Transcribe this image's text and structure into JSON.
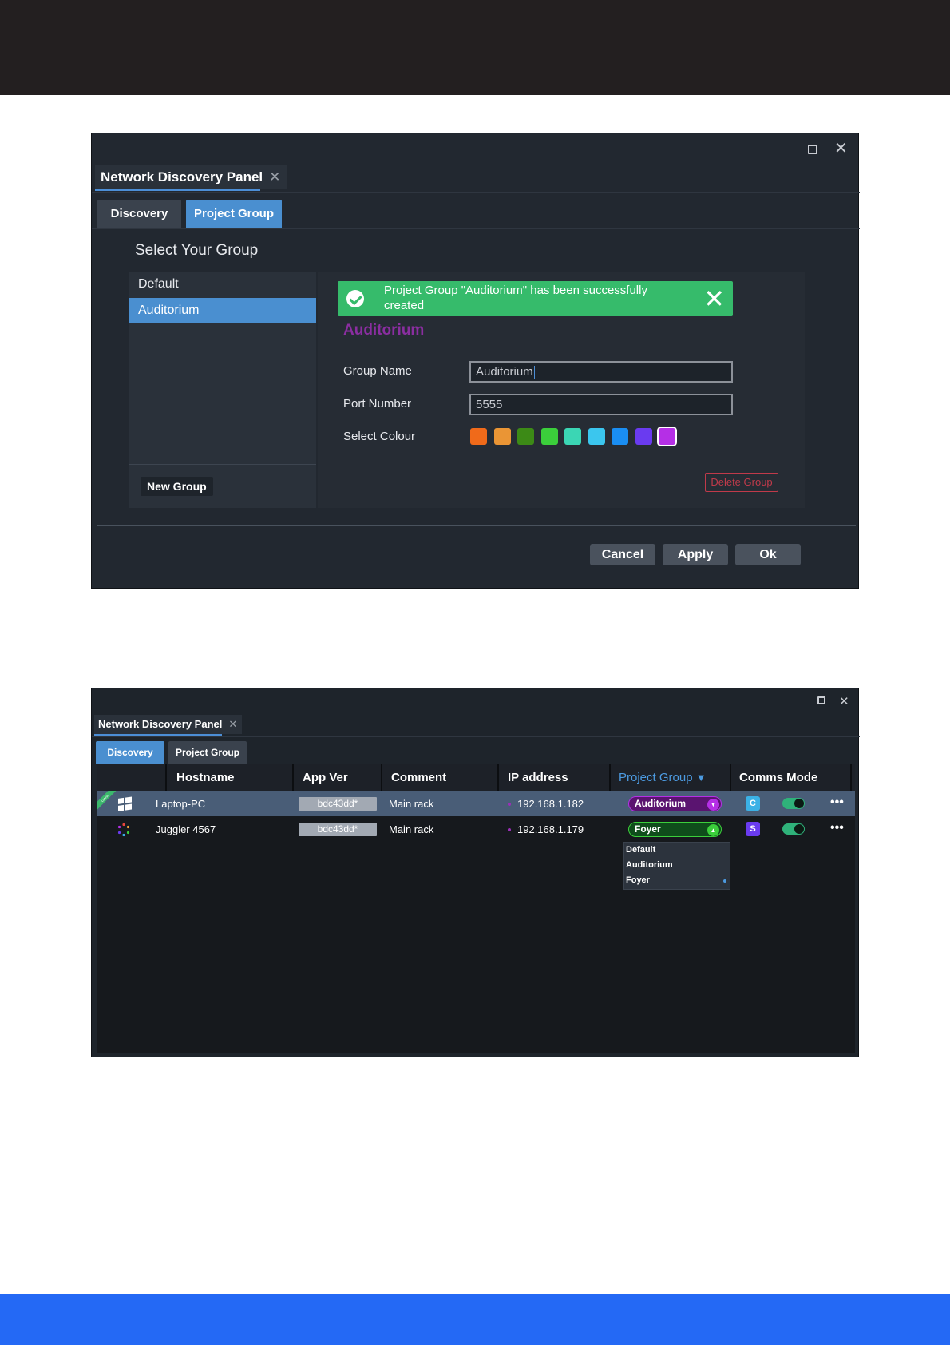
{
  "window1": {
    "panel_tab": "Network Discovery Panel",
    "tabs": [
      "Discovery",
      "Project Group"
    ],
    "heading": "Select Your Group",
    "groups": [
      "Default",
      "Auditorium"
    ],
    "new_group_label": "New Group",
    "toast_message": "Project Group \"Auditorium\" has been successfully created",
    "group_title": "Auditorium",
    "group_name_label": "Group Name",
    "group_name_value": "Auditorium",
    "port_label": "Port Number",
    "port_value": "5555",
    "colour_label": "Select Colour",
    "colours": [
      "#f06a1a",
      "#ea9535",
      "#3c8a16",
      "#3bcf3b",
      "#3bd6b4",
      "#3bc6ee",
      "#1a8ef2",
      "#6a3bf0",
      "#b52fe6"
    ],
    "selected_colour": "#b52fe6",
    "delete_label": "Delete Group",
    "cancel_label": "Cancel",
    "apply_label": "Apply",
    "ok_label": "Ok"
  },
  "window2": {
    "panel_tab": "Network Discovery Panel",
    "tabs": [
      "Discovery",
      "Project Group"
    ],
    "columns": [
      "Hostname",
      "App Ver",
      "Comment",
      "IP address",
      "Project Group",
      "Comms Mode"
    ],
    "rows": [
      {
        "hostname": "Laptop-PC",
        "app_ver": "bdc43dd*",
        "comment": "Main rack",
        "ip": "192.168.1.182",
        "project_group": "Auditorium",
        "pg_color": "#5a1470",
        "pg_accent": "#b52fe6",
        "mode": "C",
        "mode_color": "#3bb1e6",
        "latest_label": "Latest"
      },
      {
        "hostname": "Juggler 4567",
        "app_ver": "bdc43dd*",
        "comment": "Main rack",
        "ip": "192.168.1.179",
        "project_group": "Foyer",
        "pg_color": "#0f4d1b",
        "pg_accent": "#3bcf3b",
        "mode": "S",
        "mode_color": "#6a3bf0"
      }
    ],
    "dropdown_options": [
      "Default",
      "Auditorium",
      "Foyer"
    ]
  }
}
